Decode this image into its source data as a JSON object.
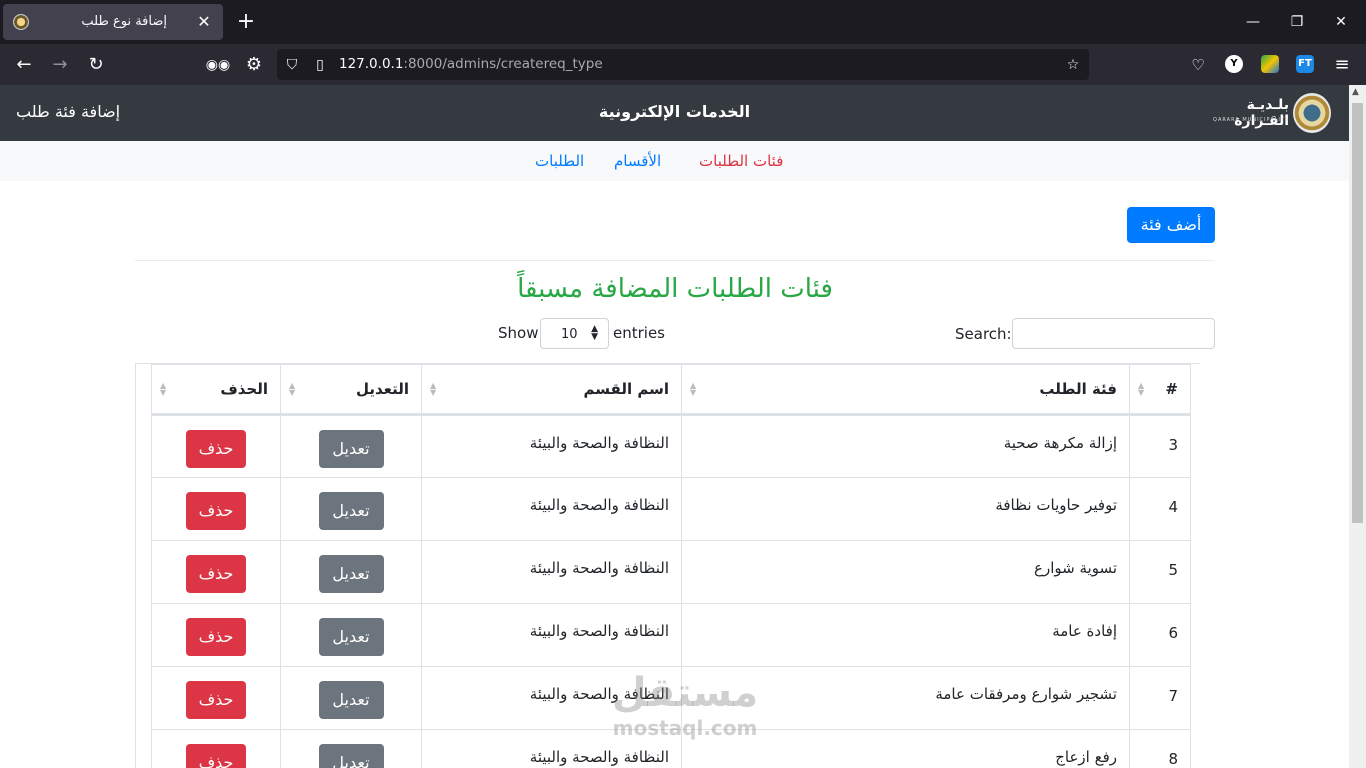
{
  "browser": {
    "tab_title": "إضافة نوع طلب",
    "tab_close": "✕",
    "new_tab": "+",
    "url_host": "127.0.0.1",
    "url_path": ":8000/admins/createreq_type",
    "window_controls": [
      "—",
      "❐",
      "✕"
    ],
    "extensions": [
      "pocket-icon",
      "y-icon",
      "globe-icon",
      "ft-icon",
      "menu-icon"
    ],
    "ext_y_label": "Y",
    "ext_ft_label": "FT"
  },
  "header": {
    "left_title": "إضافة فئة طلب",
    "center_title": "الخدمات الإلكترونية",
    "logo_name": "بلـديـة القـرارة",
    "logo_sub": "QARARA MUNICIPALITY"
  },
  "subnav": {
    "item_1": "فئات الطلبات",
    "item_2": "الأقسام",
    "item_3": "الطلبات",
    "colors": {
      "active": "#dc3545",
      "link": "#007bff"
    }
  },
  "add_button_label": "أضف فئة",
  "heading": "فئات الطلبات المضافة مسبقاً",
  "datatable": {
    "show_label": "Show",
    "page_length": "10",
    "entries_label": "entries",
    "search_label": "Search:",
    "search_value": "",
    "columns": [
      "#",
      "فئة الطلب",
      "اسم القسم",
      "التعديل",
      "الحذف"
    ],
    "rows": [
      {
        "id": "3",
        "category": "إزالة مكرهة صحية",
        "department": "النظافة والصحة والبيئة"
      },
      {
        "id": "4",
        "category": "توفير حاويات نظافة",
        "department": "النظافة والصحة والبيئة"
      },
      {
        "id": "5",
        "category": "تسوية شوارع",
        "department": "النظافة والصحة والبيئة"
      },
      {
        "id": "6",
        "category": "إفادة عامة",
        "department": "النظافة والصحة والبيئة"
      },
      {
        "id": "7",
        "category": "تشجير شوارع ومرفقات عامة",
        "department": "النظافة والصحة والبيئة"
      },
      {
        "id": "8",
        "category": "رفع ازعاج",
        "department": "النظافة والصحة والبيئة"
      }
    ],
    "edit_label": "تعديل",
    "delete_label": "حذف"
  },
  "watermark": {
    "ar": "مستقل",
    "en": "mostaql.com"
  }
}
